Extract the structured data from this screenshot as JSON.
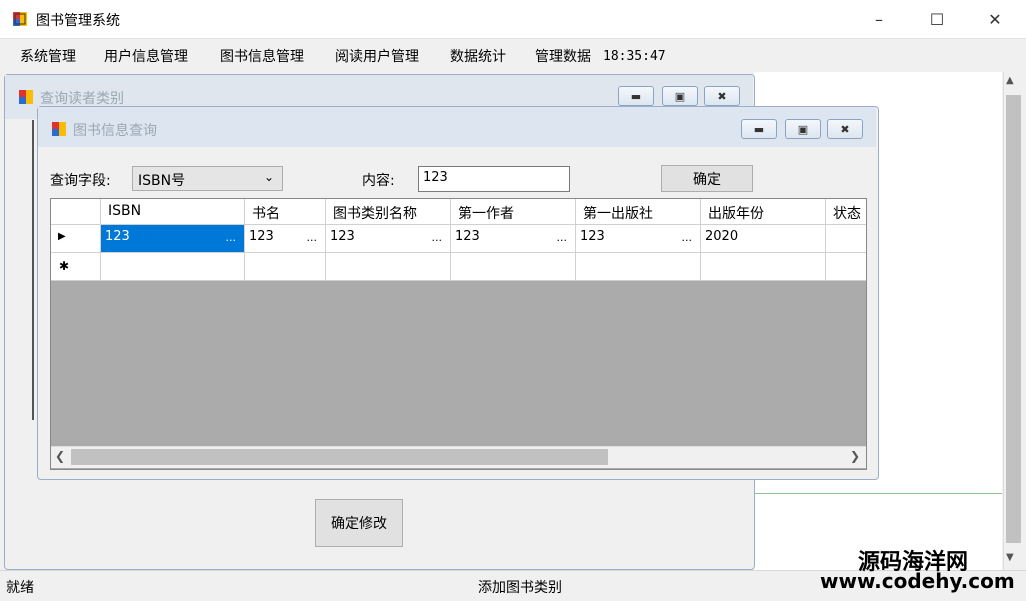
{
  "app": {
    "title": "图书管理系统"
  },
  "menu": {
    "items": [
      "系统管理",
      "用户信息管理",
      "图书信息管理",
      "阅读用户管理",
      "数据统计",
      "管理数据"
    ],
    "clock": "18:35:47"
  },
  "bg_window": {
    "title": "查询读者类别",
    "confirm_label": "确定修改"
  },
  "query_window": {
    "title": "图书信息查询",
    "field_label": "查询字段:",
    "field_value": "ISBN号",
    "content_label": "内容:",
    "content_value": "123",
    "confirm_label": "确定",
    "columns": [
      "ISBN",
      "书名",
      "图书类别名称",
      "第一作者",
      "第一出版社",
      "出版年份",
      "状态"
    ],
    "rows": [
      {
        "cells": [
          "123",
          "123",
          "123",
          "123",
          "123",
          "2020",
          ""
        ],
        "ellipsis": [
          "...",
          "...",
          "...",
          "...",
          "...",
          "",
          ""
        ]
      }
    ]
  },
  "status": {
    "left": "就绪",
    "center": "添加图书类别"
  },
  "watermark": {
    "line1": "源码海洋网",
    "line2": "www.codehy.com"
  },
  "colors": {
    "selection": "#0078d7",
    "grid_bg": "#ababab",
    "accent_green": "#8fc28f"
  }
}
